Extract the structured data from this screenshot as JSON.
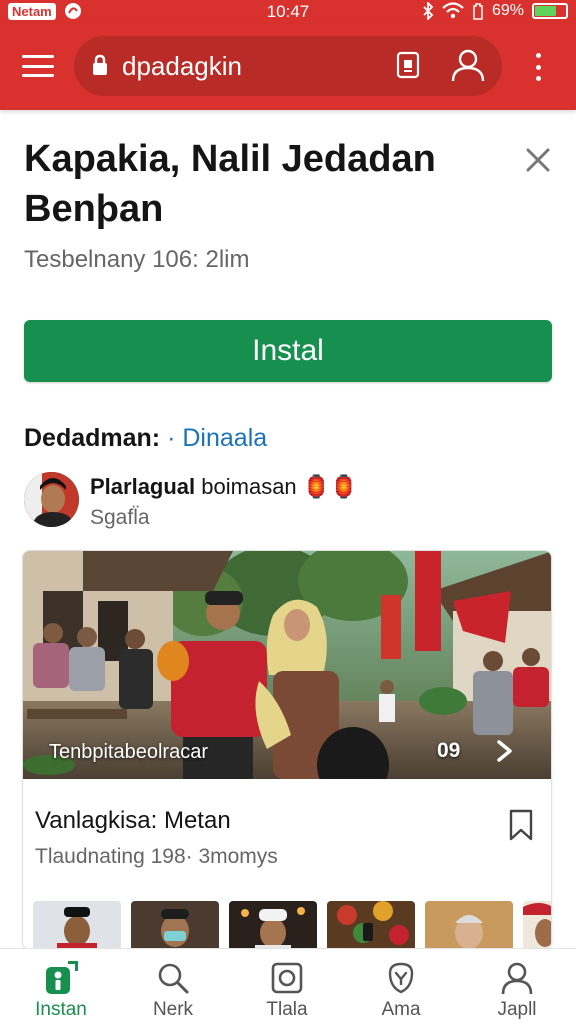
{
  "status_bar": {
    "carrier": "Netam",
    "time": "10:47",
    "battery": "69%",
    "battery_level": 0.69
  },
  "browser": {
    "url": "dpadagkin",
    "icons": [
      "menu-icon",
      "lock-icon",
      "tab-switcher-icon",
      "account-icon",
      "more-vertical-icon"
    ]
  },
  "app": {
    "title": "Kapakia, Nalil Jedadan Benþan",
    "subtitle": "Tesbelnany 106: 2lim",
    "install_label": "Instal"
  },
  "section": {
    "label": "Dedadman:",
    "separator": "·",
    "link": "Dinaala"
  },
  "author": {
    "name_bold": "Plarlagual",
    "name_rest": "boimasan",
    "emojis": "🏮🏮",
    "sub": "Sgafl̈a"
  },
  "card": {
    "image_caption": "Tenbpitabeolracar",
    "image_counter": "09",
    "title": "Vanlagkisa: Metan",
    "sub": "Tlaudnating 198· 3momys",
    "icons": [
      "next-arrow-icon",
      "bookmark-icon"
    ]
  },
  "bottom_nav": [
    {
      "label": "Instan",
      "icon": "install-icon",
      "active": true
    },
    {
      "label": "Nerk",
      "icon": "search-icon",
      "active": false
    },
    {
      "label": "Tlala",
      "icon": "camera-icon",
      "active": false
    },
    {
      "label": "Ama",
      "icon": "notification-icon",
      "active": false
    },
    {
      "label": "Japll",
      "icon": "profile-icon",
      "active": false
    }
  ],
  "colors": {
    "brand_red": "#d9322e",
    "install_green": "#178f4f",
    "link_blue": "#1a73b8"
  }
}
